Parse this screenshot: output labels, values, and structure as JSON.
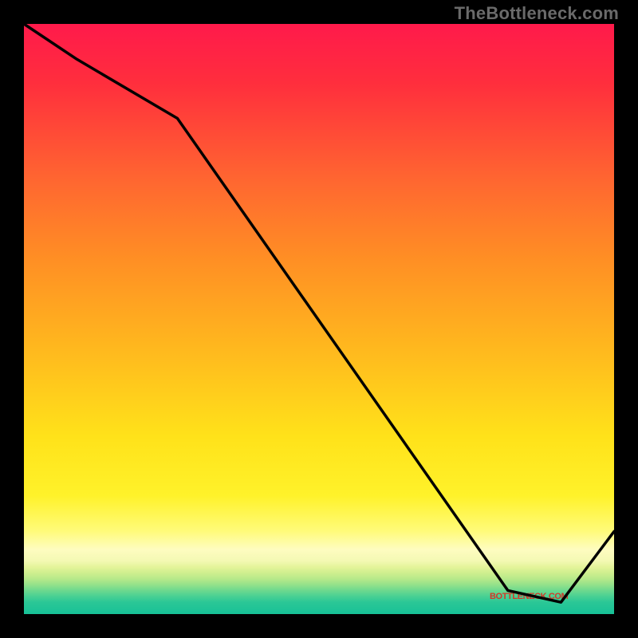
{
  "watermark": "TheBottleneck.com",
  "label_text": "BOTTLENECK.COM",
  "chart_data": {
    "type": "line",
    "title": "",
    "xlabel": "",
    "ylabel": "",
    "xlim": [
      0,
      100
    ],
    "ylim": [
      0,
      100
    ],
    "series": [
      {
        "name": "curve",
        "x": [
          0,
          9,
          26,
          82,
          91,
          100
        ],
        "values": [
          100,
          94,
          84,
          4,
          2,
          14
        ]
      }
    ],
    "gradient_stops": [
      {
        "pct": 0,
        "color": "#ff1a4b"
      },
      {
        "pct": 10,
        "color": "#ff2e3d"
      },
      {
        "pct": 27,
        "color": "#ff6830"
      },
      {
        "pct": 40,
        "color": "#ff8f24"
      },
      {
        "pct": 55,
        "color": "#ffb81e"
      },
      {
        "pct": 70,
        "color": "#ffe21a"
      },
      {
        "pct": 80,
        "color": "#fff22a"
      },
      {
        "pct": 86,
        "color": "#fffb7a"
      },
      {
        "pct": 89,
        "color": "#fefcc0"
      },
      {
        "pct": 91,
        "color": "#f4f9b4"
      },
      {
        "pct": 92,
        "color": "#e4f49a"
      },
      {
        "pct": 93,
        "color": "#d0ef8f"
      },
      {
        "pct": 94,
        "color": "#b6e98a"
      },
      {
        "pct": 95,
        "color": "#95e28a"
      },
      {
        "pct": 96,
        "color": "#6fd98e"
      },
      {
        "pct": 97,
        "color": "#48d093"
      },
      {
        "pct": 98,
        "color": "#2bc796"
      },
      {
        "pct": 100,
        "color": "#17c197"
      }
    ],
    "label_position": {
      "x": 85,
      "y": 3
    }
  }
}
